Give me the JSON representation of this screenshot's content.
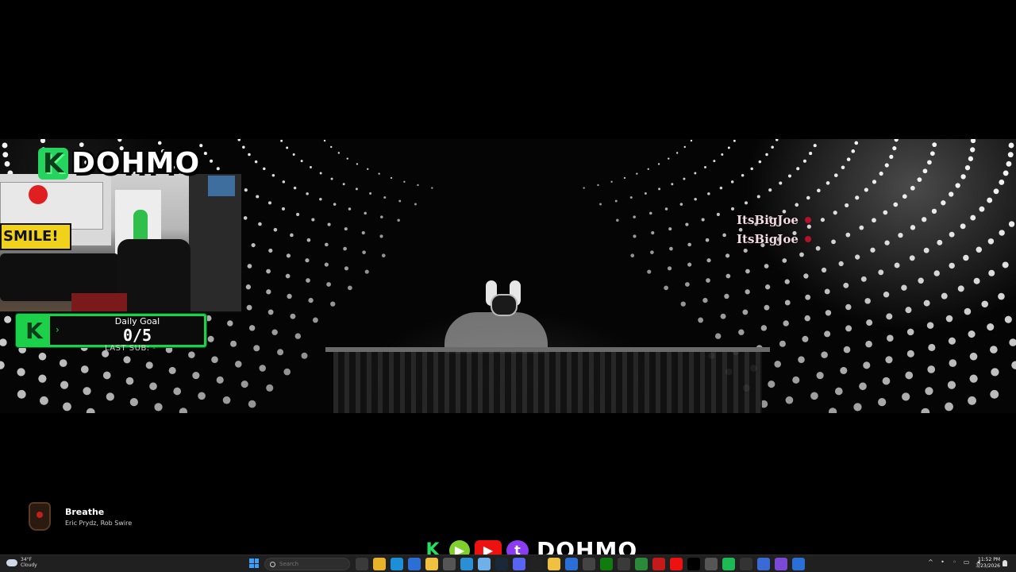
{
  "logo": {
    "k": "K",
    "name": "DOHMO"
  },
  "webcam": {
    "banner": "SMILE!"
  },
  "goal": {
    "title": "Daily Goal",
    "count": "0/5",
    "last_sub_label": "LAST SUB:",
    "last_sub_value": "-"
  },
  "chat": [
    {
      "user": "ItsBigJoe"
    },
    {
      "user": "ItsBigJoe"
    }
  ],
  "now_playing": {
    "title": "Breathe",
    "artist": "Eric Prydz, Rob Swire"
  },
  "socials": {
    "kick": "K",
    "rumble": "▶",
    "youtube": "▶",
    "twitch": "t",
    "name": "DOHMO"
  },
  "taskbar": {
    "weather_temp": "34°F",
    "weather_desc": "Cloudy",
    "search_placeholder": "Search",
    "clock_time": "11:52 PM",
    "clock_date": "3/23/2026",
    "apps": [
      {
        "icon": "task-view-icon",
        "color": "#3a3a3a"
      },
      {
        "icon": "file-explorer-icon",
        "color": "#e8b12a"
      },
      {
        "icon": "edge-icon",
        "color": "#1d8fd8"
      },
      {
        "icon": "mail-icon",
        "color": "#2b6fd6"
      },
      {
        "icon": "folder-icon",
        "color": "#f0c040"
      },
      {
        "icon": "camera-icon",
        "color": "#555"
      },
      {
        "icon": "photos-icon",
        "color": "#2b8fd6"
      },
      {
        "icon": "notepad-icon",
        "color": "#6fb0e8"
      },
      {
        "icon": "steam-icon",
        "color": "#1b2838"
      },
      {
        "icon": "discord-icon",
        "color": "#5865f2"
      },
      {
        "icon": "obs-icon",
        "color": "#222"
      },
      {
        "icon": "files-icon",
        "color": "#f0c040"
      },
      {
        "icon": "store-icon",
        "color": "#2b6fd6"
      },
      {
        "icon": "calculator-icon",
        "color": "#444"
      },
      {
        "icon": "xbox-icon",
        "color": "#107c10"
      },
      {
        "icon": "spreadsheet-icon",
        "color": "#3a3a3a"
      },
      {
        "icon": "chrome-icon",
        "color": "#2a8a3a"
      },
      {
        "icon": "opera-icon",
        "color": "#c41a1a"
      },
      {
        "icon": "youtube-icon",
        "color": "#ee1111"
      },
      {
        "icon": "x-icon",
        "color": "#000"
      },
      {
        "icon": "color-icon",
        "color": "#555"
      },
      {
        "icon": "spotify-icon",
        "color": "#1db954"
      },
      {
        "icon": "terminal-icon",
        "color": "#333"
      },
      {
        "icon": "photo-editor-icon",
        "color": "#3a6ad6"
      },
      {
        "icon": "copilot-icon",
        "color": "#7a4ad6"
      },
      {
        "icon": "app-icon",
        "color": "#2b6fd6"
      }
    ]
  },
  "colors": {
    "accent_green": "#1dd049",
    "chat_name": "#f3d9e2",
    "taskbar_bg": "#202020"
  }
}
